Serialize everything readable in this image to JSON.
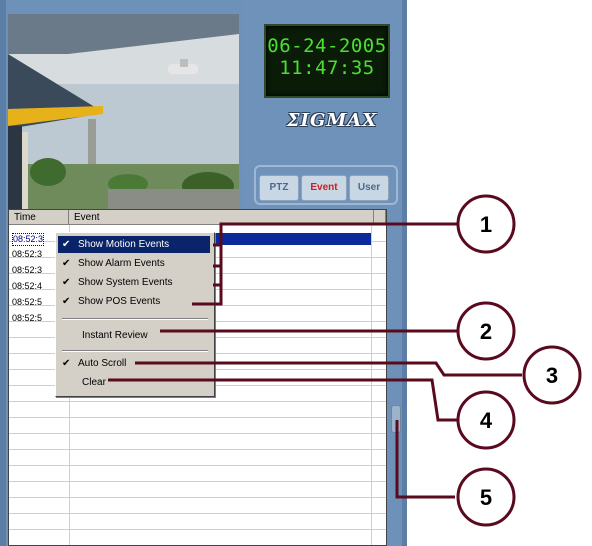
{
  "clock": {
    "date": "06-24-2005",
    "time": "11:47:35"
  },
  "logo": {
    "text": "ΣIGMAX"
  },
  "tabs": [
    {
      "label": "PTZ",
      "active": false
    },
    {
      "label": "Event",
      "active": true
    },
    {
      "label": "User",
      "active": false
    }
  ],
  "event_list": {
    "columns": [
      "Time",
      "Event"
    ],
    "times": [
      "08:52:3",
      "08:52:3",
      "08:52:3",
      "08:52:4",
      "08:52:5",
      "08:52:5"
    ]
  },
  "context_menu": {
    "items": [
      {
        "label": "Show Motion Events",
        "checked": true,
        "highlighted": true
      },
      {
        "label": "Show Alarm Events",
        "checked": true
      },
      {
        "label": "Show System Events",
        "checked": true
      },
      {
        "label": "Show POS Events",
        "checked": true
      },
      {
        "label": "Instant Review",
        "checked": false
      },
      {
        "label": "Auto Scroll",
        "checked": true
      },
      {
        "label": "Clear",
        "checked": false
      }
    ],
    "check_glyph": "✔"
  },
  "callouts": [
    "1",
    "2",
    "3",
    "4",
    "5"
  ],
  "colors": {
    "callout_line": "#5a0a1e",
    "clock_text": "#49e030",
    "active_tab": "#d11b1b",
    "menu_highlight": "#0a246a",
    "selected_row": "#0b2a9a"
  }
}
